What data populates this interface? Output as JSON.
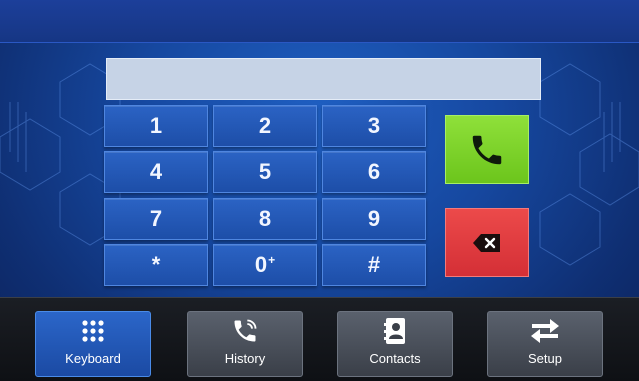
{
  "display": {
    "number": ""
  },
  "keypad": [
    {
      "label": "1",
      "sup": ""
    },
    {
      "label": "2",
      "sup": ""
    },
    {
      "label": "3",
      "sup": ""
    },
    {
      "label": "4",
      "sup": ""
    },
    {
      "label": "5",
      "sup": ""
    },
    {
      "label": "6",
      "sup": ""
    },
    {
      "label": "7",
      "sup": ""
    },
    {
      "label": "8",
      "sup": ""
    },
    {
      "label": "9",
      "sup": ""
    },
    {
      "label": "*",
      "sup": ""
    },
    {
      "label": "0",
      "sup": "+"
    },
    {
      "label": "#",
      "sup": ""
    }
  ],
  "actions": {
    "call_icon": "phone-icon",
    "backspace_icon": "backspace-icon",
    "call_color": "#7ed32a",
    "backspace_color": "#e03a3f"
  },
  "nav": [
    {
      "label": "Keyboard",
      "icon": "keypad-grid-icon",
      "active": true
    },
    {
      "label": "History",
      "icon": "phone-call-icon",
      "active": false
    },
    {
      "label": "Contacts",
      "icon": "contacts-book-icon",
      "active": false
    },
    {
      "label": "Setup",
      "icon": "swap-arrows-icon",
      "active": false
    }
  ]
}
